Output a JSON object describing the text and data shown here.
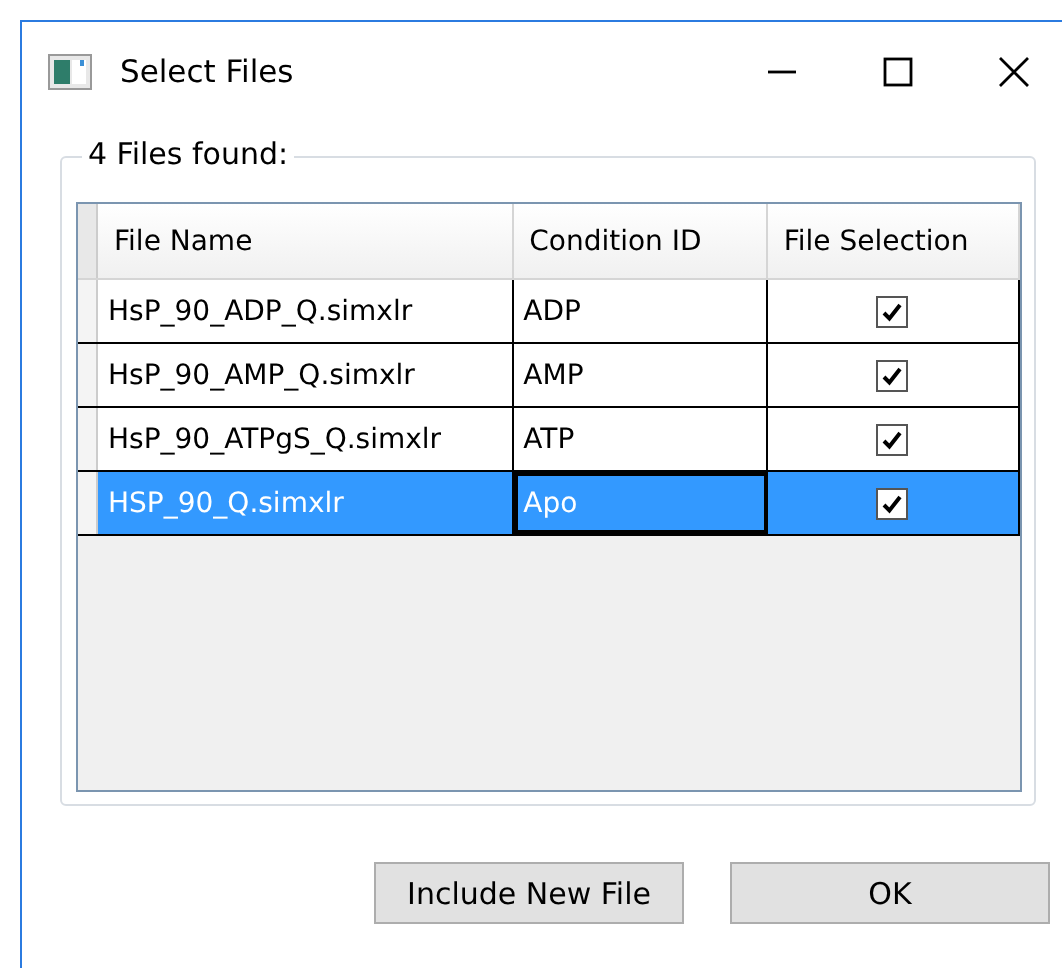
{
  "window": {
    "title": "Select Files"
  },
  "group": {
    "title": "4 Files found:"
  },
  "table": {
    "columns": [
      "File Name",
      "Condition ID",
      "File Selection"
    ],
    "rows": [
      {
        "file_name": "HsP_90_ADP_Q.simxlr",
        "condition_id": "ADP",
        "checked": true,
        "selected": false
      },
      {
        "file_name": "HsP_90_AMP_Q.simxlr",
        "condition_id": "AMP",
        "checked": true,
        "selected": false
      },
      {
        "file_name": "HsP_90_ATPgS_Q.simxlr",
        "condition_id": "ATP",
        "checked": true,
        "selected": false
      },
      {
        "file_name": "HSP_90_Q.simxlr",
        "condition_id": "Apo",
        "checked": true,
        "selected": true
      }
    ]
  },
  "buttons": [
    "Include New File",
    "OK"
  ]
}
